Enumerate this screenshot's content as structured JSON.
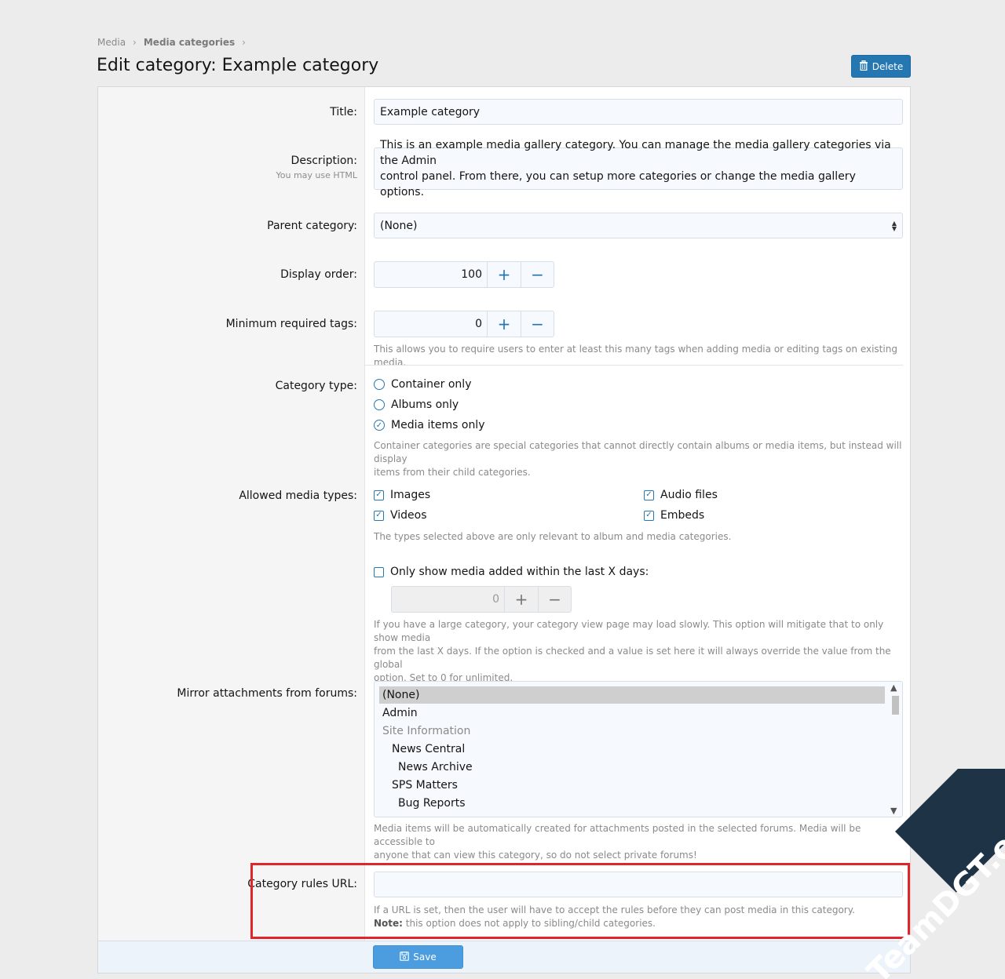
{
  "breadcrumb": {
    "items": [
      "Media",
      "Media categories"
    ],
    "separator": "›"
  },
  "page": {
    "title": "Edit category: Example category"
  },
  "actions": {
    "delete_label": "Delete",
    "save_label": "Save"
  },
  "form": {
    "title": {
      "label": "Title:",
      "value": "Example category"
    },
    "description": {
      "label": "Description:",
      "hint": "You may use HTML",
      "value_line1": "This is an example media gallery category. You can manage the media gallery categories via the Admin",
      "value_line2": "control panel. From there, you can setup more categories or change the media gallery options."
    },
    "parent_category": {
      "label": "Parent category:",
      "value": "(None)"
    },
    "display_order": {
      "label": "Display order:",
      "value": "100",
      "plus": "+",
      "minus": "−"
    },
    "min_tags": {
      "label": "Minimum required tags:",
      "value": "0",
      "plus": "+",
      "minus": "−",
      "explain": "This allows you to require users to enter at least this many tags when adding media or editing tags on existing media."
    },
    "category_type": {
      "label": "Category type:",
      "options": [
        {
          "label": "Container only",
          "checked": false
        },
        {
          "label": "Albums only",
          "checked": false
        },
        {
          "label": "Media items only",
          "checked": true
        }
      ],
      "explain_line1": "Container categories are special categories that cannot directly contain albums or media items, but instead will display",
      "explain_line2": "items from their child categories."
    },
    "media_types": {
      "label": "Allowed media types:",
      "options": [
        {
          "label": "Images",
          "checked": true
        },
        {
          "label": "Audio files",
          "checked": true
        },
        {
          "label": "Videos",
          "checked": true
        },
        {
          "label": "Embeds",
          "checked": true
        }
      ],
      "explain": "The types selected above are only relevant to album and media categories."
    },
    "recent_limit": {
      "label": "Only show media added within the last X days:",
      "checked": false,
      "value": "0",
      "plus": "+",
      "minus": "−",
      "explain_line1": "If you have a large category, your category view page may load slowly. This option will mitigate that to only show media",
      "explain_line2": "from the last X days. If the option is checked and a value is set here it will always override the value from the global",
      "explain_line3": "option. Set to 0 for unlimited."
    },
    "mirror_forums": {
      "label": "Mirror attachments from forums:",
      "options": [
        "(None)",
        "Admin",
        "Site Information",
        "News Central",
        "News Archive",
        "SPS Matters",
        "Bug Reports"
      ],
      "explain_line1": "Media items will be automatically created for attachments posted in the selected forums. Media will be accessible to",
      "explain_line2": "anyone that can view this category, so do not select private forums!"
    },
    "rules_url": {
      "label": "Category rules URL:",
      "value": "",
      "explain": "If a URL is set, then the user will have to accept the rules before they can post media in this category.",
      "note_label": "Note:",
      "note_text": " this option does not apply to sibling/child categories."
    }
  },
  "watermark": {
    "text": "TeamDGT.org"
  },
  "colors": {
    "accent": "#2577b1",
    "highlight": "#e0262b",
    "save": "#4b9de0"
  }
}
